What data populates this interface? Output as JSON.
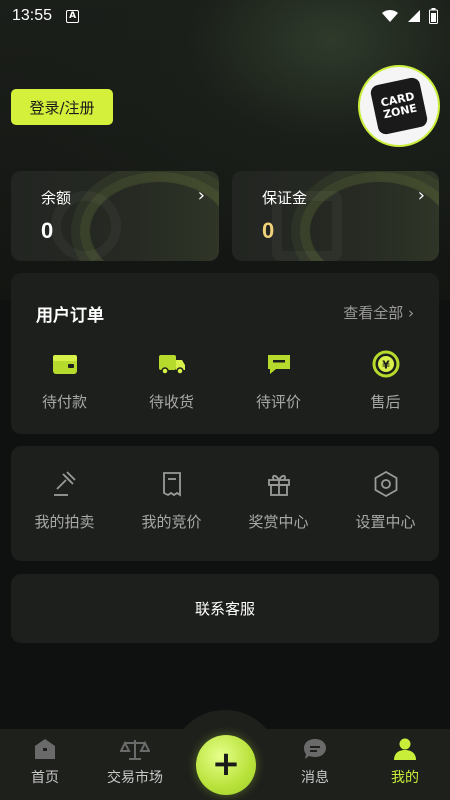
{
  "status_bar": {
    "time": "13:55",
    "notification_badge": "A"
  },
  "header": {
    "login_label": "登录/注册",
    "avatar_logo": "CARD ZONE"
  },
  "balance": {
    "label": "余额",
    "value": "0",
    "arrow": "›"
  },
  "deposit": {
    "label": "保证金",
    "value": "0",
    "arrow": "›"
  },
  "orders": {
    "title": "用户订单",
    "view_all": "查看全部 ›",
    "items": [
      {
        "label": "待付款",
        "icon": "wallet-icon"
      },
      {
        "label": "待收货",
        "icon": "truck-icon"
      },
      {
        "label": "待评价",
        "icon": "comment-icon"
      },
      {
        "label": "售后",
        "icon": "yen-refresh-icon"
      }
    ]
  },
  "tools": {
    "items": [
      {
        "label": "我的拍卖",
        "icon": "gavel-icon"
      },
      {
        "label": "我的竞价",
        "icon": "receipt-icon"
      },
      {
        "label": "奖赏中心",
        "icon": "gift-icon"
      },
      {
        "label": "设置中心",
        "icon": "hexagon-settings-icon"
      }
    ]
  },
  "service": {
    "label": "联系客服"
  },
  "tabbar": {
    "items": [
      {
        "label": "首页",
        "icon": "home-icon",
        "active": false
      },
      {
        "label": "交易市场",
        "icon": "scale-icon",
        "active": false
      },
      {
        "label": "",
        "icon": "plus-icon",
        "active": false
      },
      {
        "label": "消息",
        "icon": "chat-icon",
        "active": false
      },
      {
        "label": "我的",
        "icon": "person-icon",
        "active": true
      }
    ]
  },
  "colors": {
    "accent": "#c8ee3a",
    "background": "#0f1110",
    "panel": "#1d1f1c",
    "deposit_value": "#f0d27a"
  }
}
